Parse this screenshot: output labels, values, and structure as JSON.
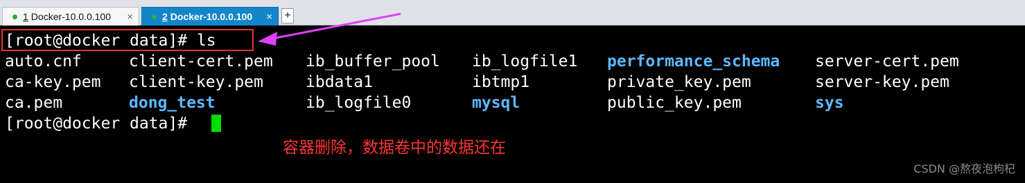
{
  "tabs": [
    {
      "number": "1",
      "title": "Docker-10.0.0.100",
      "active": false
    },
    {
      "number": "2",
      "title": "Docker-10.0.0.100",
      "active": true
    }
  ],
  "add_tab_label": "+",
  "close_glyph": "×",
  "terminal": {
    "command_line": "[root@docker data]# ls",
    "prompt_line": "[root@docker data]# ",
    "listing": [
      [
        {
          "name": "auto.cnf",
          "kind": "file"
        },
        {
          "name": "client-cert.pem",
          "kind": "file"
        },
        {
          "name": "ib_buffer_pool",
          "kind": "file"
        },
        {
          "name": "ib_logfile1",
          "kind": "file"
        },
        {
          "name": "performance_schema",
          "kind": "dir"
        },
        {
          "name": "server-cert.pem",
          "kind": "file"
        }
      ],
      [
        {
          "name": "ca-key.pem",
          "kind": "file"
        },
        {
          "name": "client-key.pem",
          "kind": "file"
        },
        {
          "name": "ibdata1",
          "kind": "file"
        },
        {
          "name": "ibtmp1",
          "kind": "file"
        },
        {
          "name": "private_key.pem",
          "kind": "file"
        },
        {
          "name": "server-key.pem",
          "kind": "file"
        }
      ],
      [
        {
          "name": "ca.pem",
          "kind": "file"
        },
        {
          "name": "dong_test",
          "kind": "dir"
        },
        {
          "name": "ib_logfile0",
          "kind": "file"
        },
        {
          "name": "mysql",
          "kind": "dir"
        },
        {
          "name": "public_key.pem",
          "kind": "file"
        },
        {
          "name": "sys",
          "kind": "dir"
        }
      ]
    ]
  },
  "annotation_text": "容器删除，数据卷中的数据还在",
  "watermark": "CSDN @熬夜泡枸杞",
  "colors": {
    "terminal_bg": "#000000",
    "text": "#ffffff",
    "directory": "#5db8ff",
    "cursor": "#00e000",
    "annotation": "#ff3333",
    "arrow": "#e040fb",
    "active_tab": "#1485c9"
  }
}
